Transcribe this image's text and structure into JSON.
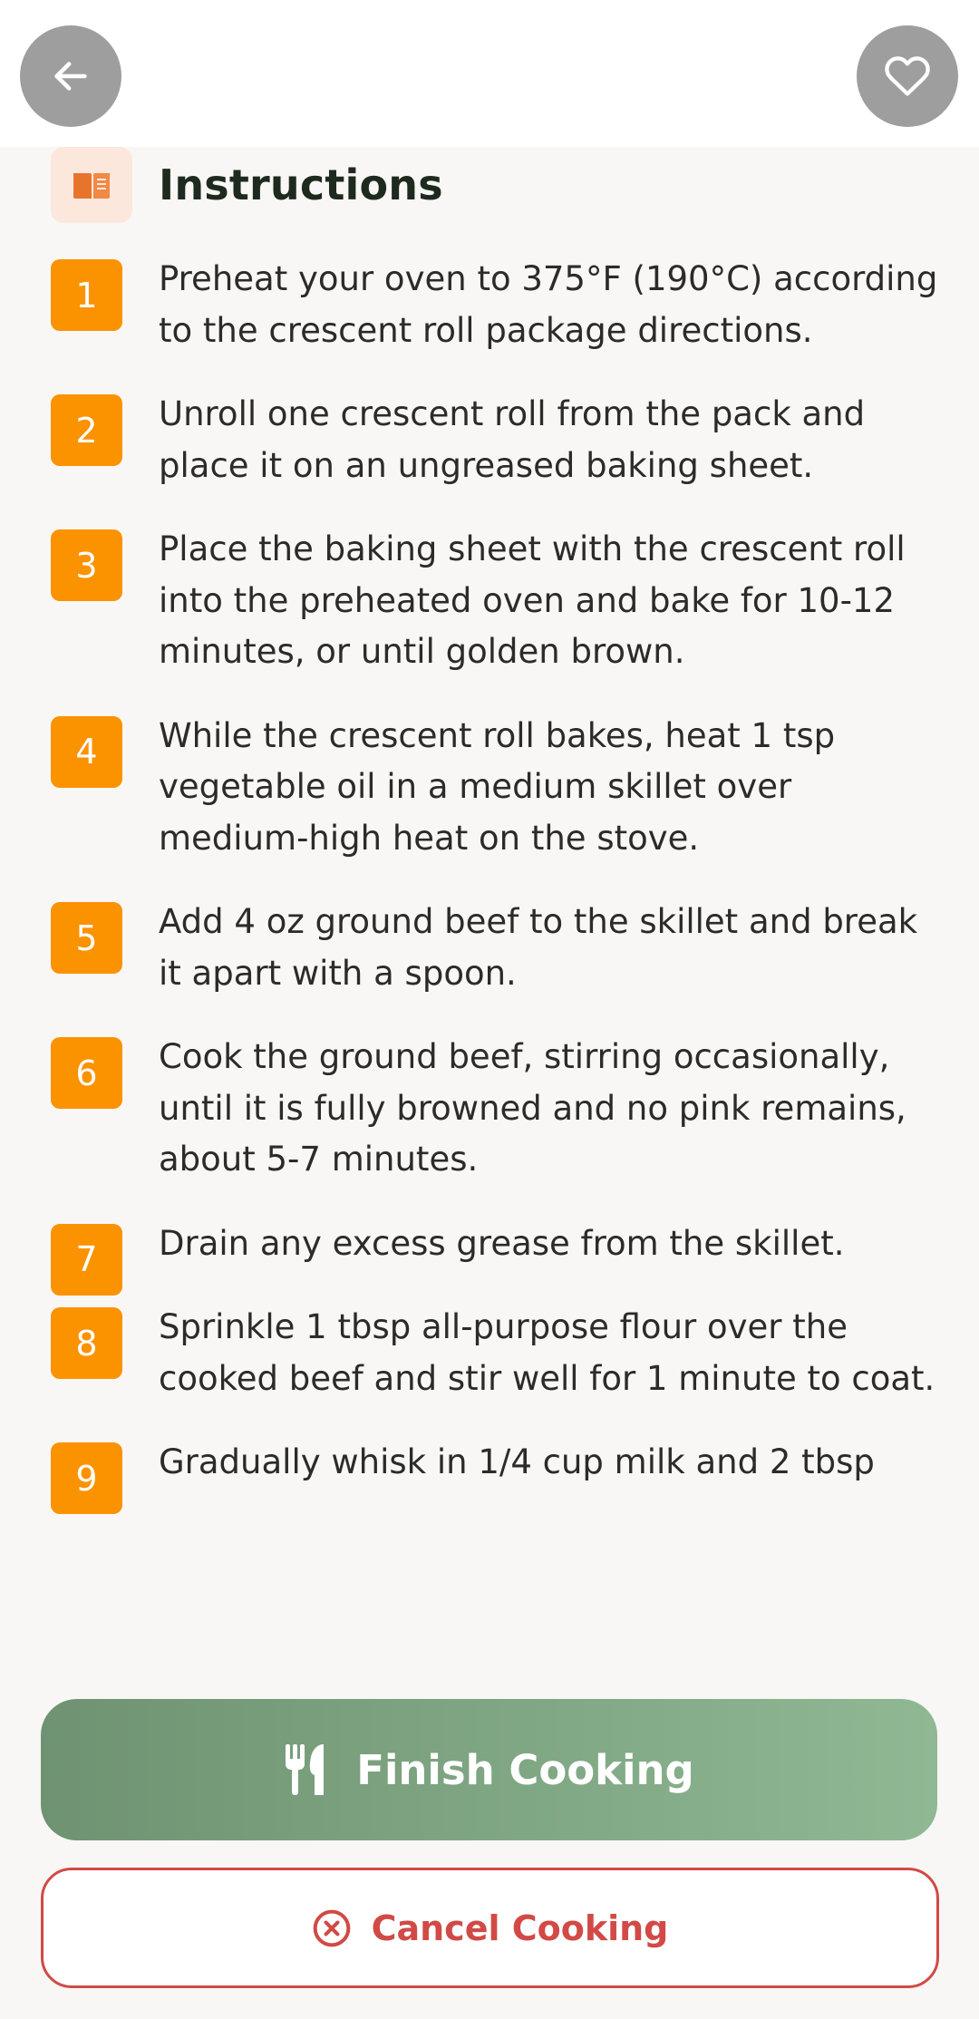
{
  "header": {
    "back_icon": "arrow-left-icon",
    "favorite_icon": "heart-icon"
  },
  "instructions": {
    "title": "Instructions",
    "icon": "book-open-icon",
    "steps": [
      {
        "number": "1",
        "text": "Preheat your oven to 375°F (190°C) according to the crescent roll package directions."
      },
      {
        "number": "2",
        "text": "Unroll one crescent roll from the pack and place it on an ungreased baking sheet."
      },
      {
        "number": "3",
        "text": "Place the baking sheet with the crescent roll into the preheated oven and bake for 10-12 minutes, or until golden brown."
      },
      {
        "number": "4",
        "text": "While the crescent roll bakes, heat 1 tsp vegetable oil in a medium skillet over medium-high heat on the stove."
      },
      {
        "number": "5",
        "text": "Add 4 oz ground beef to the skillet and break it apart with a spoon."
      },
      {
        "number": "6",
        "text": "Cook the ground beef, stirring occasionally, until it is fully browned and no pink remains, about 5-7 minutes."
      },
      {
        "number": "7",
        "text": "Drain any excess grease from the skillet."
      },
      {
        "number": "8",
        "text": "Sprinkle 1 tbsp all-purpose flour over the cooked beef and stir well for 1 minute to coat."
      },
      {
        "number": "9",
        "text": "Gradually whisk in 1/4 cup milk and 2 tbsp"
      }
    ]
  },
  "actions": {
    "finish_label": "Finish Cooking",
    "finish_icon": "utensils-icon",
    "cancel_label": "Cancel Cooking",
    "cancel_icon": "x-circle-icon"
  },
  "colors": {
    "accent_orange": "#FB9200",
    "finish_green_start": "#6F9372",
    "finish_green_end": "#8FB893",
    "cancel_red": "#D14A46",
    "icon_badge_bg": "#FCE7DD"
  }
}
